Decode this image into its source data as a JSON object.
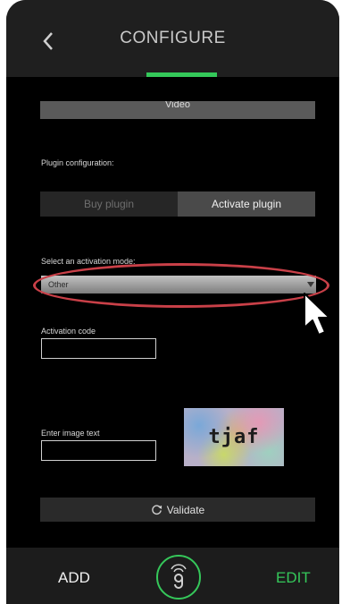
{
  "header": {
    "title": "CONFIGURE"
  },
  "video_button": {
    "label": "Video"
  },
  "plugin_section": {
    "label": "Plugin configuration:",
    "segments": [
      {
        "label": "Buy plugin",
        "selected": false
      },
      {
        "label": "Activate plugin",
        "selected": true
      }
    ]
  },
  "activation_mode": {
    "label": "Select an activation mode:",
    "selected_value": "Other"
  },
  "activation_code": {
    "label": "Activation code",
    "value": ""
  },
  "image_text": {
    "label": "Enter image text",
    "value": "",
    "captcha_text": "tjaf"
  },
  "validate_button": {
    "label": "Validate",
    "icon": "refresh-icon"
  },
  "bottom_bar": {
    "add_label": "ADD",
    "edit_label": "EDIT",
    "logo_icon": "logo-icon"
  },
  "colors": {
    "accent_green": "#34c85a",
    "highlight_red": "#c94048",
    "background": "#000000"
  }
}
